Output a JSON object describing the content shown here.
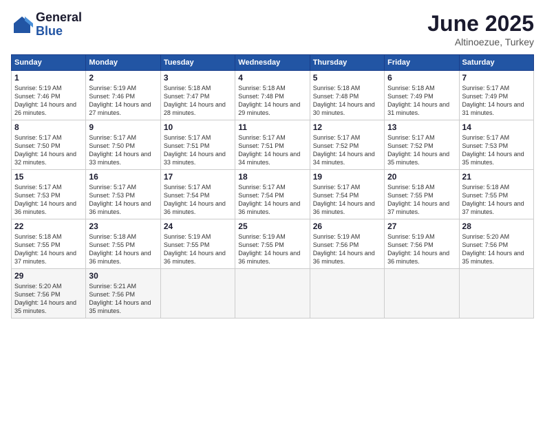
{
  "logo": {
    "general": "General",
    "blue": "Blue"
  },
  "title": "June 2025",
  "location": "Altinoezue, Turkey",
  "days_header": [
    "Sunday",
    "Monday",
    "Tuesday",
    "Wednesday",
    "Thursday",
    "Friday",
    "Saturday"
  ],
  "weeks": [
    [
      {
        "day": "1",
        "sunrise": "Sunrise: 5:19 AM",
        "sunset": "Sunset: 7:46 PM",
        "daylight": "Daylight: 14 hours and 26 minutes."
      },
      {
        "day": "2",
        "sunrise": "Sunrise: 5:19 AM",
        "sunset": "Sunset: 7:46 PM",
        "daylight": "Daylight: 14 hours and 27 minutes."
      },
      {
        "day": "3",
        "sunrise": "Sunrise: 5:18 AM",
        "sunset": "Sunset: 7:47 PM",
        "daylight": "Daylight: 14 hours and 28 minutes."
      },
      {
        "day": "4",
        "sunrise": "Sunrise: 5:18 AM",
        "sunset": "Sunset: 7:48 PM",
        "daylight": "Daylight: 14 hours and 29 minutes."
      },
      {
        "day": "5",
        "sunrise": "Sunrise: 5:18 AM",
        "sunset": "Sunset: 7:48 PM",
        "daylight": "Daylight: 14 hours and 30 minutes."
      },
      {
        "day": "6",
        "sunrise": "Sunrise: 5:18 AM",
        "sunset": "Sunset: 7:49 PM",
        "daylight": "Daylight: 14 hours and 31 minutes."
      },
      {
        "day": "7",
        "sunrise": "Sunrise: 5:17 AM",
        "sunset": "Sunset: 7:49 PM",
        "daylight": "Daylight: 14 hours and 31 minutes."
      }
    ],
    [
      {
        "day": "8",
        "sunrise": "Sunrise: 5:17 AM",
        "sunset": "Sunset: 7:50 PM",
        "daylight": "Daylight: 14 hours and 32 minutes."
      },
      {
        "day": "9",
        "sunrise": "Sunrise: 5:17 AM",
        "sunset": "Sunset: 7:50 PM",
        "daylight": "Daylight: 14 hours and 33 minutes."
      },
      {
        "day": "10",
        "sunrise": "Sunrise: 5:17 AM",
        "sunset": "Sunset: 7:51 PM",
        "daylight": "Daylight: 14 hours and 33 minutes."
      },
      {
        "day": "11",
        "sunrise": "Sunrise: 5:17 AM",
        "sunset": "Sunset: 7:51 PM",
        "daylight": "Daylight: 14 hours and 34 minutes."
      },
      {
        "day": "12",
        "sunrise": "Sunrise: 5:17 AM",
        "sunset": "Sunset: 7:52 PM",
        "daylight": "Daylight: 14 hours and 34 minutes."
      },
      {
        "day": "13",
        "sunrise": "Sunrise: 5:17 AM",
        "sunset": "Sunset: 7:52 PM",
        "daylight": "Daylight: 14 hours and 35 minutes."
      },
      {
        "day": "14",
        "sunrise": "Sunrise: 5:17 AM",
        "sunset": "Sunset: 7:53 PM",
        "daylight": "Daylight: 14 hours and 35 minutes."
      }
    ],
    [
      {
        "day": "15",
        "sunrise": "Sunrise: 5:17 AM",
        "sunset": "Sunset: 7:53 PM",
        "daylight": "Daylight: 14 hours and 36 minutes."
      },
      {
        "day": "16",
        "sunrise": "Sunrise: 5:17 AM",
        "sunset": "Sunset: 7:53 PM",
        "daylight": "Daylight: 14 hours and 36 minutes."
      },
      {
        "day": "17",
        "sunrise": "Sunrise: 5:17 AM",
        "sunset": "Sunset: 7:54 PM",
        "daylight": "Daylight: 14 hours and 36 minutes."
      },
      {
        "day": "18",
        "sunrise": "Sunrise: 5:17 AM",
        "sunset": "Sunset: 7:54 PM",
        "daylight": "Daylight: 14 hours and 36 minutes."
      },
      {
        "day": "19",
        "sunrise": "Sunrise: 5:17 AM",
        "sunset": "Sunset: 7:54 PM",
        "daylight": "Daylight: 14 hours and 36 minutes."
      },
      {
        "day": "20",
        "sunrise": "Sunrise: 5:18 AM",
        "sunset": "Sunset: 7:55 PM",
        "daylight": "Daylight: 14 hours and 37 minutes."
      },
      {
        "day": "21",
        "sunrise": "Sunrise: 5:18 AM",
        "sunset": "Sunset: 7:55 PM",
        "daylight": "Daylight: 14 hours and 37 minutes."
      }
    ],
    [
      {
        "day": "22",
        "sunrise": "Sunrise: 5:18 AM",
        "sunset": "Sunset: 7:55 PM",
        "daylight": "Daylight: 14 hours and 37 minutes."
      },
      {
        "day": "23",
        "sunrise": "Sunrise: 5:18 AM",
        "sunset": "Sunset: 7:55 PM",
        "daylight": "Daylight: 14 hours and 36 minutes."
      },
      {
        "day": "24",
        "sunrise": "Sunrise: 5:19 AM",
        "sunset": "Sunset: 7:55 PM",
        "daylight": "Daylight: 14 hours and 36 minutes."
      },
      {
        "day": "25",
        "sunrise": "Sunrise: 5:19 AM",
        "sunset": "Sunset: 7:55 PM",
        "daylight": "Daylight: 14 hours and 36 minutes."
      },
      {
        "day": "26",
        "sunrise": "Sunrise: 5:19 AM",
        "sunset": "Sunset: 7:56 PM",
        "daylight": "Daylight: 14 hours and 36 minutes."
      },
      {
        "day": "27",
        "sunrise": "Sunrise: 5:19 AM",
        "sunset": "Sunset: 7:56 PM",
        "daylight": "Daylight: 14 hours and 36 minutes."
      },
      {
        "day": "28",
        "sunrise": "Sunrise: 5:20 AM",
        "sunset": "Sunset: 7:56 PM",
        "daylight": "Daylight: 14 hours and 35 minutes."
      }
    ],
    [
      {
        "day": "29",
        "sunrise": "Sunrise: 5:20 AM",
        "sunset": "Sunset: 7:56 PM",
        "daylight": "Daylight: 14 hours and 35 minutes."
      },
      {
        "day": "30",
        "sunrise": "Sunrise: 5:21 AM",
        "sunset": "Sunset: 7:56 PM",
        "daylight": "Daylight: 14 hours and 35 minutes."
      },
      null,
      null,
      null,
      null,
      null
    ]
  ]
}
